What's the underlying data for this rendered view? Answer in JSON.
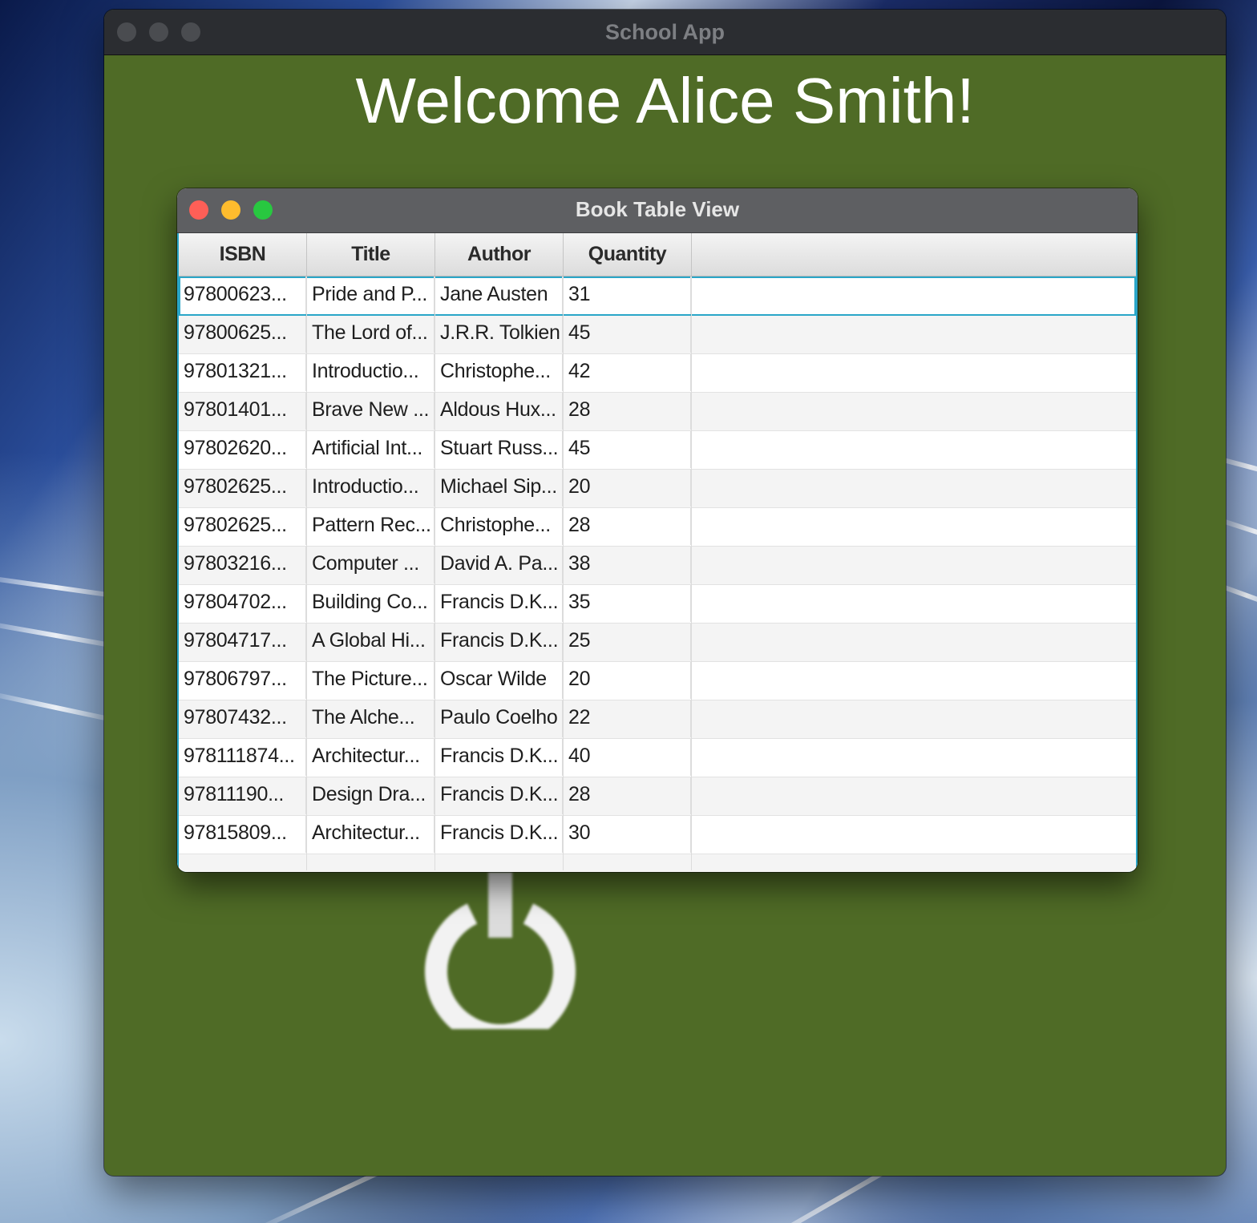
{
  "main_window": {
    "title": "School App",
    "welcome": "Welcome Alice Smith!",
    "background_color": "#4f6b26"
  },
  "book_window": {
    "title": "Book Table View",
    "traffic_lights": {
      "close": "#fe5f57",
      "minimize": "#febc2e",
      "zoom": "#28c840"
    },
    "columns": [
      "ISBN",
      "Title",
      "Author",
      "Quantity"
    ],
    "rows": [
      [
        "97800623...",
        "Pride and P...",
        "Jane Austen",
        "31"
      ],
      [
        "97800625...",
        "The Lord of...",
        "J.R.R. Tolkien",
        "45"
      ],
      [
        "97801321...",
        "Introductio...",
        "Christophe...",
        "42"
      ],
      [
        "97801401...",
        "Brave New ...",
        "Aldous Hux...",
        "28"
      ],
      [
        "97802620...",
        "Artificial Int...",
        "Stuart Russ...",
        "45"
      ],
      [
        "97802625...",
        "Introductio...",
        "Michael Sip...",
        "20"
      ],
      [
        "97802625...",
        "Pattern Rec...",
        "Christophe...",
        "28"
      ],
      [
        "97803216...",
        "Computer ...",
        "David A. Pa...",
        "38"
      ],
      [
        "97804702...",
        "Building Co...",
        "Francis D.K...",
        "35"
      ],
      [
        "97804717...",
        "A Global Hi...",
        "Francis D.K...",
        "25"
      ],
      [
        "97806797...",
        "The Picture...",
        "Oscar Wilde",
        "20"
      ],
      [
        "97807432...",
        "The Alche...",
        "Paulo Coelho",
        "22"
      ],
      [
        "978111874...",
        "Architectur...",
        "Francis D.K...",
        "40"
      ],
      [
        "97811190...",
        "Design Dra...",
        "Francis D.K...",
        "28"
      ],
      [
        "97815809...",
        "Architectur...",
        "Francis D.K...",
        "30"
      ]
    ],
    "selected_row": 0,
    "accent_color": "#2aa6c8"
  },
  "icons": {
    "power": "power-icon"
  }
}
